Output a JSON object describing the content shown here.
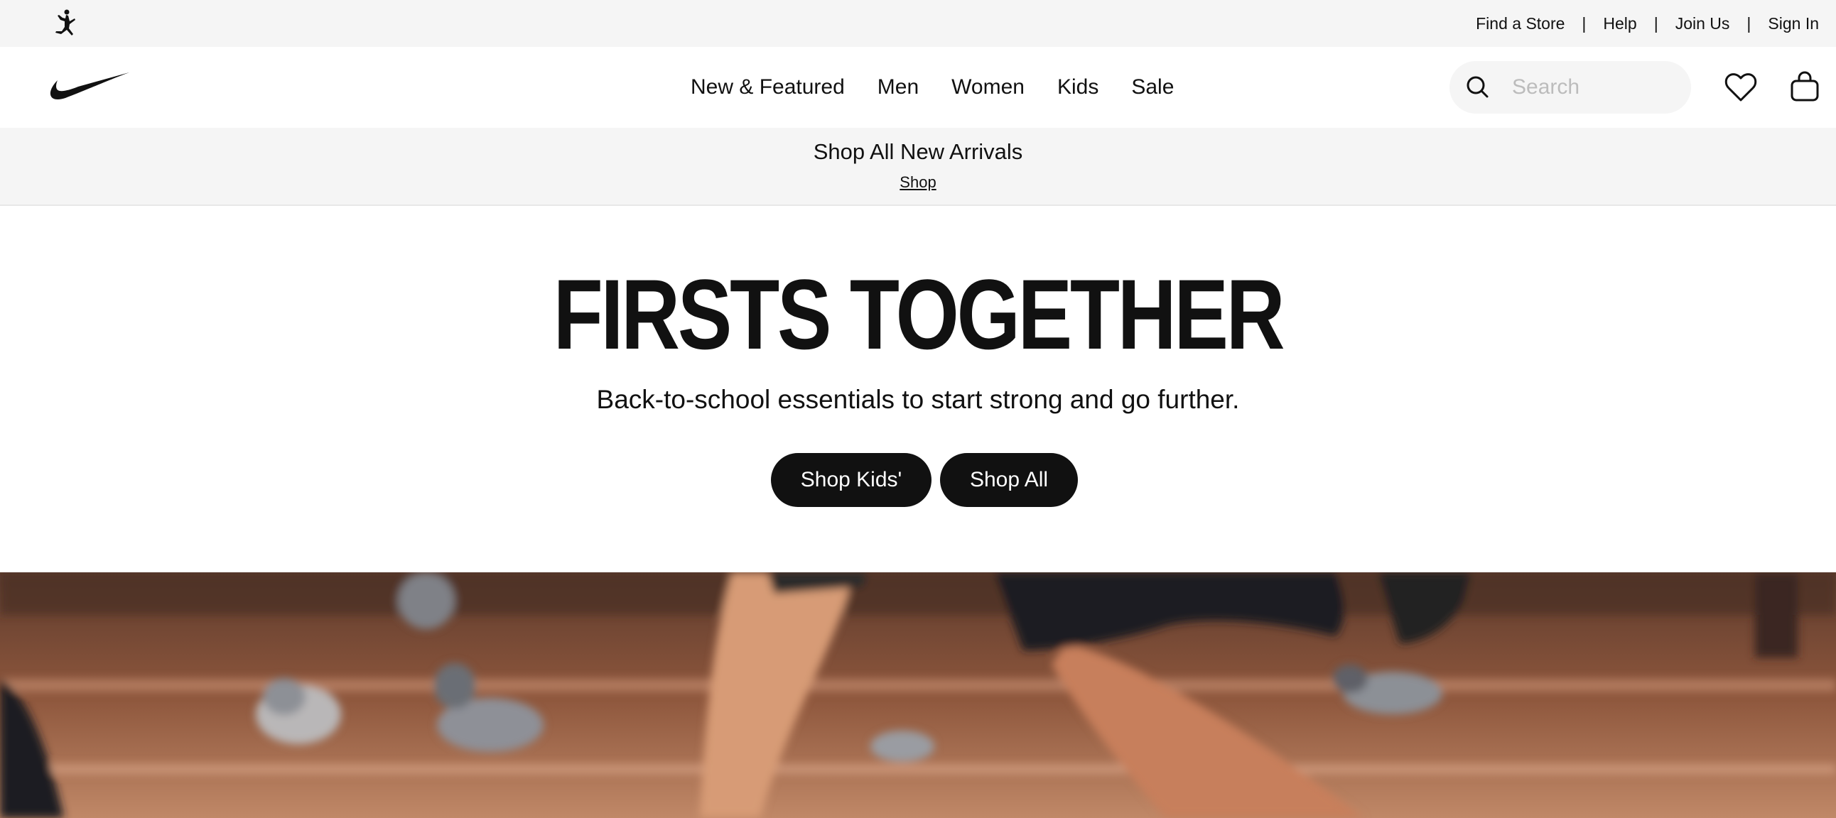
{
  "utility_bar": {
    "links": [
      "Find a Store",
      "Help",
      "Join Us",
      "Sign In"
    ],
    "separator": "|"
  },
  "nav": {
    "items": [
      "New & Featured",
      "Men",
      "Women",
      "Kids",
      "Sale"
    ],
    "search_placeholder": "Search"
  },
  "promo": {
    "title": "Shop All New Arrivals",
    "link": "Shop"
  },
  "hero": {
    "title": "FIRSTS TOGETHER",
    "subtitle": "Back-to-school essentials to start strong and go further.",
    "buttons": [
      "Shop Kids'",
      "Shop All"
    ]
  },
  "icons": {
    "brand_logo": "nike-swoosh-icon",
    "sub_brand_logo": "jordan-jumpman-icon",
    "search": "search-icon",
    "favorites": "heart-icon",
    "bag": "bag-icon"
  },
  "colors": {
    "primary": "#111111",
    "background": "#ffffff",
    "light_gray": "#f5f5f5",
    "placeholder": "#bcbcbc"
  }
}
